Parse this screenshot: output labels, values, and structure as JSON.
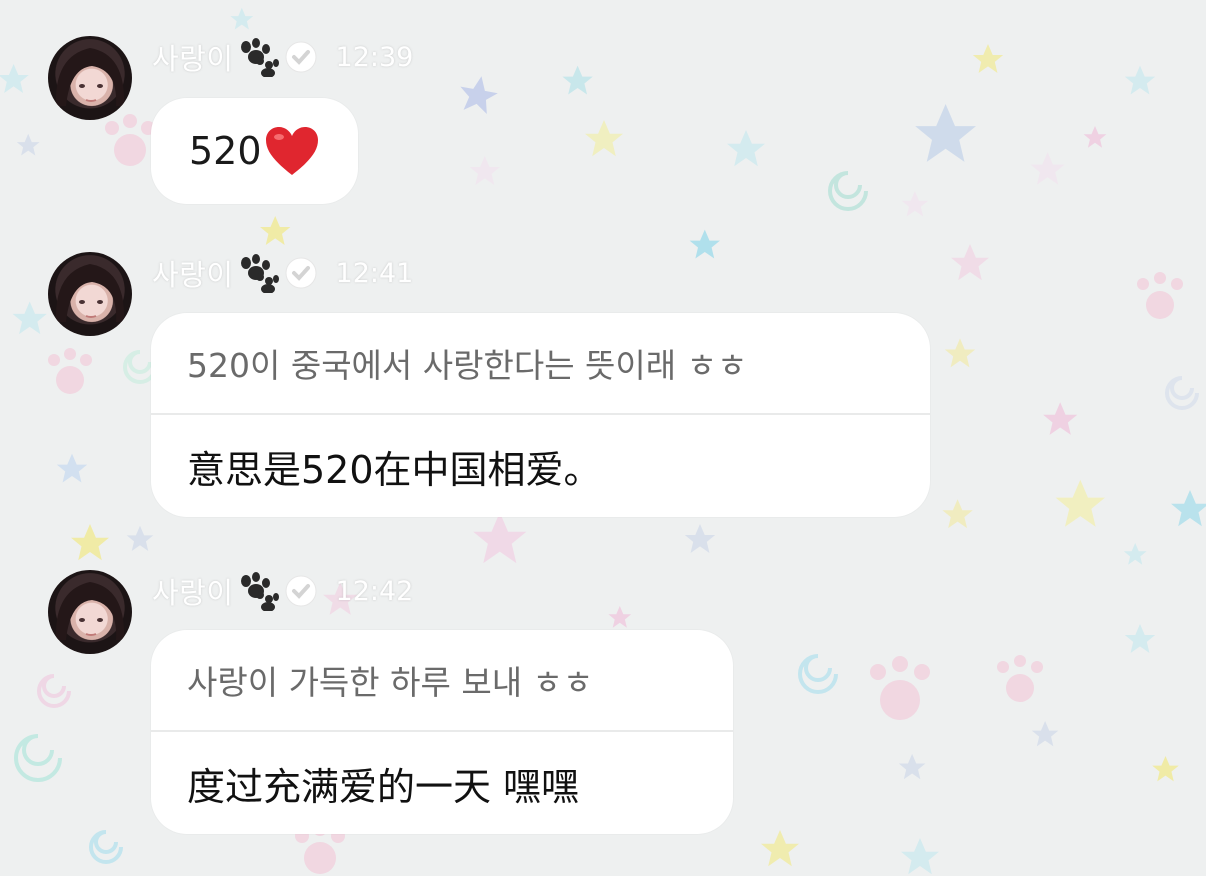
{
  "messages": [
    {
      "sender": "사랑이",
      "time": "12:39",
      "text_prefix": "520",
      "emoji": "heart"
    },
    {
      "sender": "사랑이",
      "time": "12:41",
      "original": "520이 중국에서 사랑한다는 뜻이래 ㅎㅎ",
      "translation": "意思是520在中国相爱。"
    },
    {
      "sender": "사랑이",
      "time": "12:42",
      "original": "사랑이 가득한 하루 보내 ㅎㅎ",
      "translation": "度过充满爱的一天 嘿嘿"
    }
  ],
  "colors": {
    "background": "#eef0f0",
    "bubble": "#ffffff",
    "original_text": "#6a6a6a",
    "translation_text": "#111111",
    "heart": "#e0262f"
  },
  "icons": [
    "paw-icon",
    "verified-badge-icon",
    "heart-icon"
  ]
}
